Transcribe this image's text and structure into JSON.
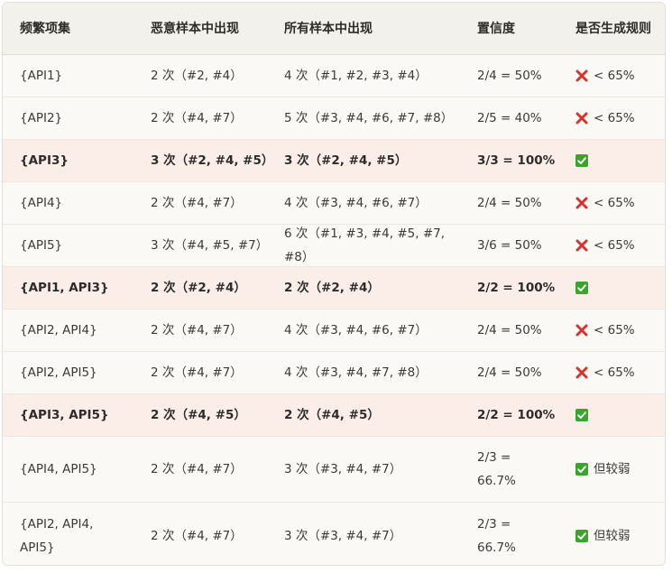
{
  "table": {
    "headers": [
      "频繁项集",
      "恶意样本中出现",
      "所有样本中出现",
      "置信度",
      "是否生成规则"
    ],
    "rows": [
      {
        "itemset": "{API1}",
        "malicious": "2 次（#2, #4）",
        "all": "4 次（#1, #2, #3, #4）",
        "confidence": "2/4 = 50%",
        "verdict_icon": "cross-mark-icon",
        "verdict": "< 65%",
        "highlight": false
      },
      {
        "itemset": "{API2}",
        "malicious": "2 次（#4, #7）",
        "all": "5 次（#3, #4, #6, #7, #8）",
        "confidence": "2/5 = 40%",
        "verdict_icon": "cross-mark-icon",
        "verdict": "< 65%",
        "highlight": false
      },
      {
        "itemset": "{API3}",
        "malicious": "3 次（#2, #4, #5）",
        "all": "3 次（#2, #4, #5）",
        "confidence": "3/3 = 100%",
        "verdict_icon": "check-mark-icon",
        "verdict": "",
        "highlight": true
      },
      {
        "itemset": "{API4}",
        "malicious": "2 次（#4, #7）",
        "all": "4 次（#3, #4, #6, #7）",
        "confidence": "2/4 = 50%",
        "verdict_icon": "cross-mark-icon",
        "verdict": "< 65%",
        "highlight": false
      },
      {
        "itemset": "{API5}",
        "malicious": "3 次（#4, #5, #7）",
        "all": "6 次（#1, #3, #4, #5, #7, #8）",
        "confidence": "3/6 = 50%",
        "verdict_icon": "cross-mark-icon",
        "verdict": "< 65%",
        "highlight": false
      },
      {
        "itemset": "{API1, API3}",
        "malicious": "2 次（#2, #4）",
        "all": "2 次（#2, #4）",
        "confidence": "2/2 = 100%",
        "verdict_icon": "check-mark-icon",
        "verdict": "",
        "highlight": true
      },
      {
        "itemset": "{API2, API4}",
        "malicious": "2 次（#4, #7）",
        "all": "4 次（#3, #4, #6, #7）",
        "confidence": "2/4 = 50%",
        "verdict_icon": "cross-mark-icon",
        "verdict": "< 65%",
        "highlight": false
      },
      {
        "itemset": "{API2, API5}",
        "malicious": "2 次（#4, #7）",
        "all": "4 次（#3, #4, #7, #8）",
        "confidence": "2/4 = 50%",
        "verdict_icon": "cross-mark-icon",
        "verdict": "< 65%",
        "highlight": false
      },
      {
        "itemset": "{API3, API5}",
        "malicious": "2 次（#4, #5）",
        "all": "2 次（#4, #5）",
        "confidence": "2/2 = 100%",
        "verdict_icon": "check-mark-icon",
        "verdict": "",
        "highlight": true
      },
      {
        "itemset": "{API4, API5}",
        "malicious": "2 次（#4, #7）",
        "all": "3 次（#3, #4, #7）",
        "confidence": "2/3 =\n66.7%",
        "verdict_icon": "check-mark-icon",
        "verdict": "但较弱",
        "highlight": false
      },
      {
        "itemset": "{API2, API4,\nAPI5}",
        "malicious": "2 次（#4, #7）",
        "all": "3 次（#3, #4, #7）",
        "confidence": "2/3 =\n66.7%",
        "verdict_icon": "check-mark-icon",
        "verdict": "但较弱",
        "highlight": false
      }
    ]
  },
  "colors": {
    "check": "#3aa42f",
    "cross": "#d8322d",
    "highlight_row": "#fbeee8",
    "header_bg": "#f3f1ec"
  }
}
